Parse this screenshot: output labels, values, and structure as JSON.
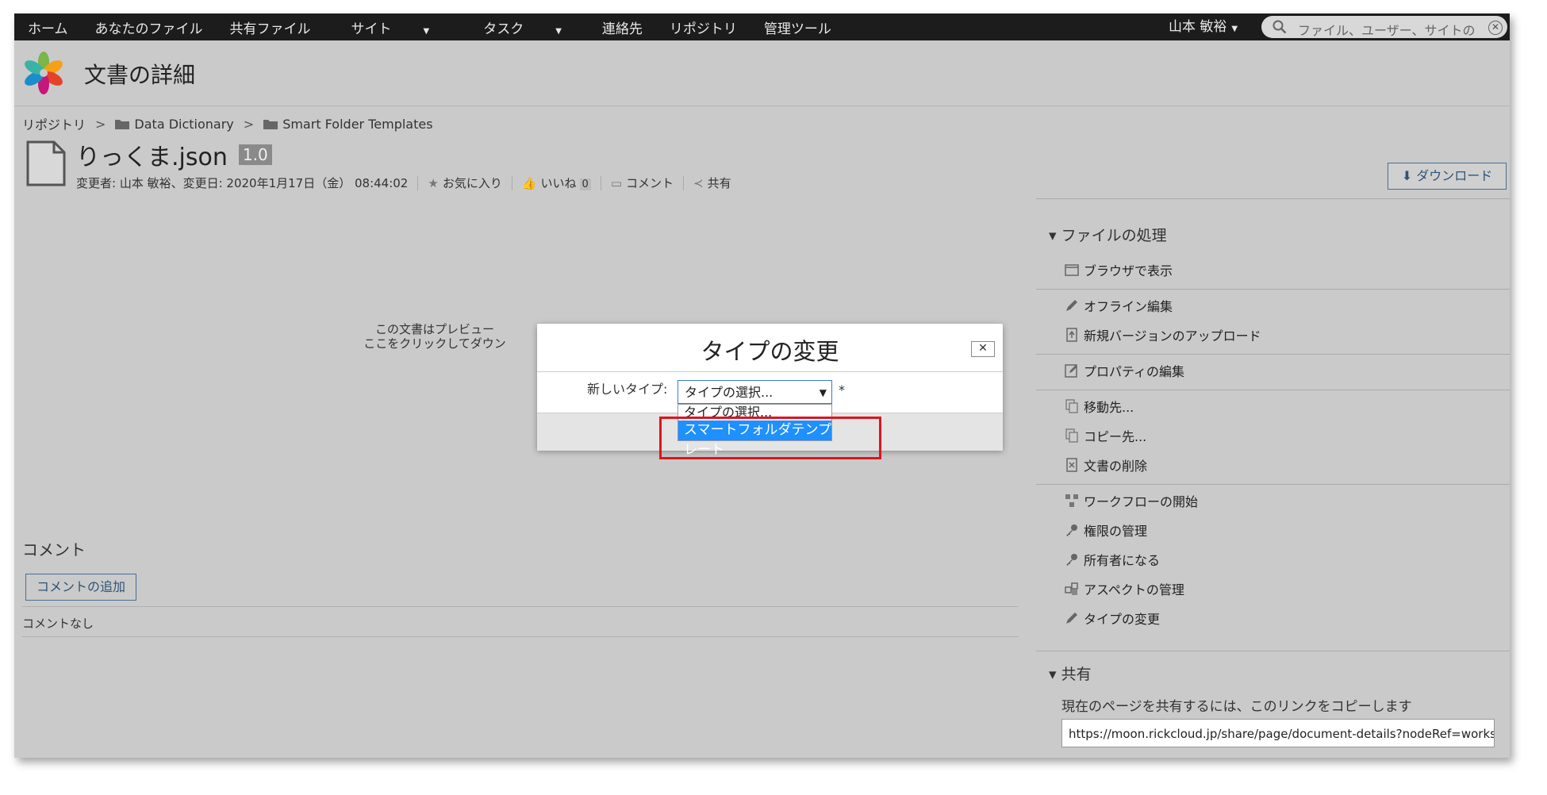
{
  "topnav": {
    "items": [
      "ホーム",
      "あなたのファイル",
      "共有ファイル",
      "サイト",
      "タスク",
      "連絡先",
      "リポジトリ",
      "管理ツール"
    ],
    "user": "山本 敏裕",
    "search_placeholder": "ファイル、ユーザー、サイトの"
  },
  "header": {
    "title": "文書の詳細"
  },
  "breadcrumb": {
    "root": "リポジトリ",
    "sep": ">",
    "folder1": "Data Dictionary",
    "folder2": "Smart Folder Templates"
  },
  "document": {
    "name": "りっくま.json",
    "version": "1.0",
    "modified": "変更者: 山本 敏裕、変更日: 2020年1月17日（金） 08:44:02",
    "favorite": "お気に入り",
    "like": "いいね",
    "like_count": "0",
    "comment": "コメント",
    "share": "共有"
  },
  "download_button": "ダウンロード",
  "preview": {
    "line1": "この文書はプレビュー",
    "line2": "ここをクリックしてダウン"
  },
  "comments": {
    "title": "コメント",
    "add_button": "コメントの追加",
    "empty": "コメントなし"
  },
  "actions_panel": {
    "title": "ファイルの処理",
    "items": [
      "ブラウザで表示",
      "オフライン編集",
      "新規バージョンのアップロード",
      "プロパティの編集",
      "移動先...",
      "コピー先...",
      "文書の削除",
      "ワークフローの開始",
      "権限の管理",
      "所有者になる",
      "アスペクトの管理",
      "タイプの変更"
    ]
  },
  "share_panel": {
    "title": "共有",
    "text": "現在のページを共有するには、このリンクをコピーします",
    "link": "https://moon.rickcloud.jp/share/page/document-details?nodeRef=workspace://SpacesStore/"
  },
  "dialog": {
    "title": "タイプの変更",
    "close": "✕",
    "label": "新しいタイプ:",
    "select_value": "タイプの選択...",
    "required": "*",
    "options": [
      "タイプの選択...",
      "スマートフォルダテンプレート"
    ]
  },
  "colors": {
    "highlight_box": "#e0141e",
    "selected_option": "#1e90ff",
    "link_button": "#2f5478"
  }
}
